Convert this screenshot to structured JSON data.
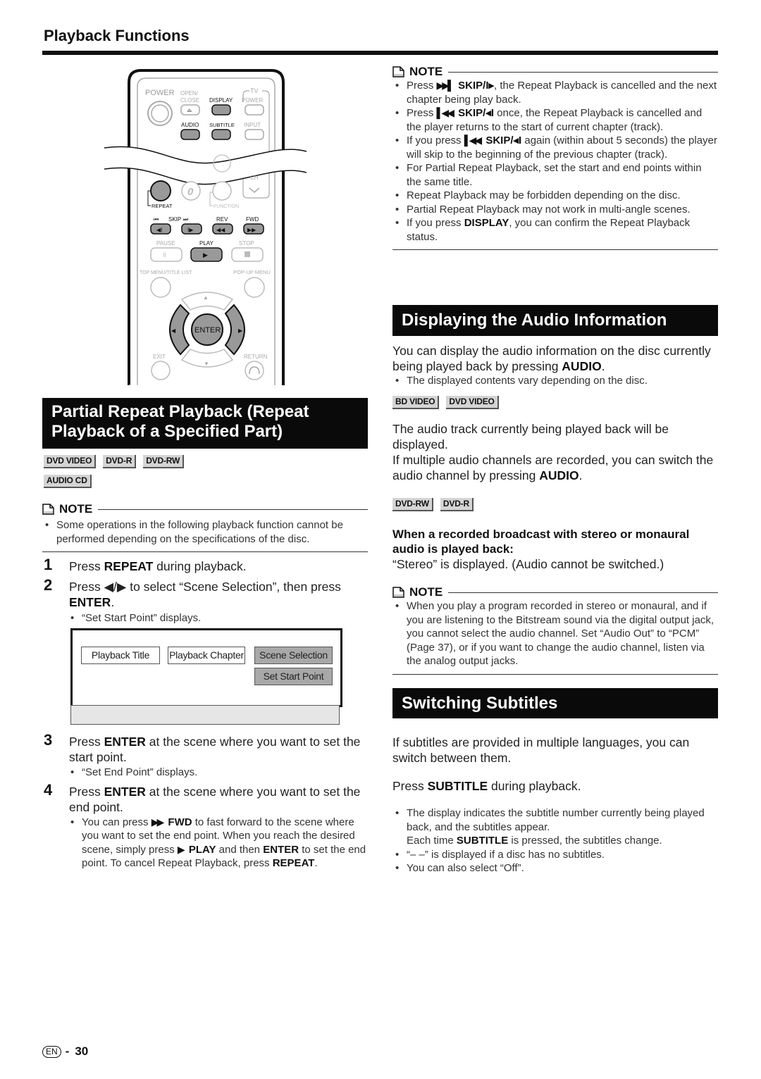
{
  "header": {
    "section_title": "Playback Functions"
  },
  "remote": {
    "labels": {
      "power": "POWER",
      "open_close": "OPEN/ CLOSE",
      "display": "DISPLAY",
      "tv": "TV",
      "tv_power": "POWER",
      "audio": "AUDIO",
      "subtitle": "SUBTITLE",
      "input": "INPUT",
      "ch": "CH",
      "zero": "0",
      "repeat": "REPEAT",
      "function": "FUNCTION",
      "skip": "SKIP",
      "rev": "REV",
      "fwd": "FWD",
      "pause": "PAUSE",
      "play": "PLAY",
      "stop": "STOP",
      "top_menu": "TOP MENU/TITLE LIST",
      "popup_menu": "POP-UP MENU",
      "enter": "ENTER",
      "exit": "EXIT",
      "return": "RETURN"
    }
  },
  "partial_repeat": {
    "heading": "Partial Repeat Playback (Repeat Playback of a Specified Part)",
    "badges": [
      "DVD VIDEO",
      "DVD-R",
      "DVD-RW",
      "AUDIO CD"
    ],
    "note_label": "NOTE",
    "note_items": [
      "Some operations in the following playback function cannot be performed depending on the specifications of the disc."
    ],
    "steps": [
      {
        "num": "1",
        "pre": "Press ",
        "bold": "REPEAT",
        "post": " during playback."
      },
      {
        "num": "2",
        "pre": "Press ◀/▶ to select “Scene Selection”, then press ",
        "bold": "ENTER",
        "post": ".",
        "sub": "“Set Start Point” displays."
      },
      {
        "num": "3",
        "pre": "Press ",
        "bold": "ENTER",
        "post": " at the scene where you want to set the start point.",
        "sub": "“Set End Point” displays."
      },
      {
        "num": "4",
        "pre": "Press ",
        "bold": "ENTER",
        "post": " at the scene where you want to set the end point."
      }
    ],
    "step4_sub": {
      "t1": "You can press ",
      "fwd_glyph": "▶▶",
      "b1": " FWD",
      "t2": " to fast forward to the scene where you want to set the end point. When you reach the desired scene, simply press ",
      "play_glyph": "▶",
      "b2": " PLAY",
      "t3": " and then ",
      "b3": "ENTER",
      "t4": " to set the end point. To cancel Repeat Playback, press ",
      "b4": "REPEAT",
      "t5": "."
    },
    "screen": {
      "buttons": [
        "Playback Title",
        "Playback Chapter",
        "Scene Selection"
      ],
      "selected": "Scene Selection",
      "sub_button": "Set Start Point"
    }
  },
  "right_note": {
    "note_label": "NOTE",
    "items": [
      {
        "pre": "Press ",
        "glyph": "▶▶▌",
        "bold": " SKIP/I▸",
        "post": ", the Repeat Playback is cancelled and the next chapter being play back."
      },
      {
        "pre": "Press ",
        "glyph": "▌◀◀",
        "bold": " SKIP/◂I",
        "post": " once, the Repeat Playback is cancelled and the player returns to the start of current chapter (track)."
      },
      {
        "pre": "If you press ",
        "glyph": "▌◀◀",
        "bold": " SKIP/◂I",
        "post": " again (within about 5 seconds) the player will skip to the beginning of the previous chapter (track)."
      },
      {
        "pre": "For Partial Repeat Playback, set the start and end points within the same title.",
        "glyph": "",
        "bold": "",
        "post": ""
      },
      {
        "pre": "Repeat Playback may be forbidden depending on the disc.",
        "glyph": "",
        "bold": "",
        "post": ""
      },
      {
        "pre": "Partial Repeat Playback may not work in multi-angle scenes.",
        "glyph": "",
        "bold": "",
        "post": ""
      },
      {
        "pre": "If you press ",
        "glyph": "",
        "bold": "DISPLAY",
        "post": ", you can confirm the Repeat Playback status."
      }
    ]
  },
  "audio_info": {
    "heading": "Displaying the Audio Information",
    "intro_pre": "You can display the audio information on the disc currently being played back by pressing ",
    "intro_bold": "AUDIO",
    "intro_post": ".",
    "intro_bullet": "The displayed contents vary depending on the disc.",
    "badges_1": [
      "BD VIDEO",
      "DVD VIDEO"
    ],
    "para1": "The audio track currently being played back will be displayed.",
    "para2_pre": "If multiple audio channels are recorded, you can switch the audio channel by pressing ",
    "para2_bold": "AUDIO",
    "para2_post": ".",
    "badges_2": [
      "DVD-RW",
      "DVD-R"
    ],
    "subheading": "When a recorded broadcast with stereo or monaural audio is played back:",
    "stereo_text": "“Stereo” is displayed. (Audio cannot be switched.)",
    "note_label": "NOTE",
    "note_items": [
      "When you play a program recorded in stereo or monaural, and if you are listening to the Bitstream sound via the digital output jack, you cannot select the audio channel. Set “Audio Out” to “PCM” (Page 37), or if you want to change the audio channel, listen via the analog output jacks."
    ]
  },
  "subtitles": {
    "heading": "Switching Subtitles",
    "intro": "If subtitles are provided in multiple languages, you can switch between them.",
    "press_pre": "Press ",
    "press_bold": "SUBTITLE",
    "press_post": " during playback.",
    "bullet1": "The display indicates the subtitle number currently being played back, and the subtitles appear.",
    "bullet1_b_pre": "Each time ",
    "bullet1_b_bold": "SUBTITLE",
    "bullet1_b_post": " is pressed, the subtitles change.",
    "bullet2": "“– –” is displayed if a disc has no subtitles.",
    "bullet3": "You can also select “Off”."
  },
  "footer": {
    "lang": "EN",
    "separator": "-",
    "page_number": "30"
  }
}
